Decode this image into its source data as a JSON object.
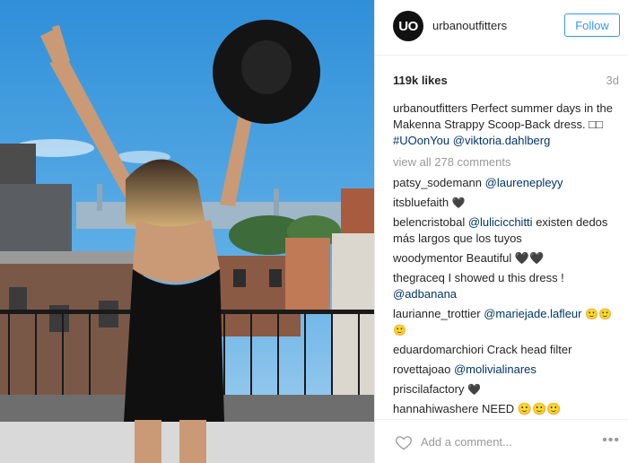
{
  "post": {
    "username": "urbanoutfitters",
    "avatar_text": "UO",
    "follow_label": "Follow",
    "likes": "119k likes",
    "age": "3d",
    "caption": {
      "user": "urbanoutfitters",
      "text": "Perfect summer days in the Makenna Strappy Scoop-Back dress.",
      "boxes": "□□",
      "hashtag": "#UOonYou",
      "mention": "@viktoria.dahlberg"
    },
    "view_all": "view all 278 comments",
    "comments": [
      {
        "user": "patsy_sodemann",
        "mention": "@laurenepleyy",
        "text": ""
      },
      {
        "user": "itsbluefaith",
        "text": "🖤"
      },
      {
        "user": "belencristobal",
        "mention": "@lulicicchitti",
        "text": "existen dedos más largos que los tuyos"
      },
      {
        "user": "woodymentor",
        "text": "Beautiful 🖤🖤"
      },
      {
        "user": "thegraceq",
        "text": "I showed u this dress !",
        "mention": "@adbanana"
      },
      {
        "user": "laurianne_trottier",
        "mention": "@mariejade.lafleur",
        "text": "🙂🙂🙂"
      },
      {
        "user": "eduardomarchiori",
        "text": "Crack head filter"
      },
      {
        "user": "rovettajoao",
        "mention": "@molivialinares",
        "text": ""
      },
      {
        "user": "priscilafactory",
        "text": "🖤"
      },
      {
        "user": "hannahiwashere",
        "text": "NEED 🙂🙂🙂"
      }
    ],
    "add_comment_placeholder": "Add a comment...",
    "more_label": "•••"
  },
  "icons": {
    "heart": "heart-icon",
    "more": "more-options-icon"
  },
  "colors": {
    "accent": "#3897f0",
    "link": "#003569",
    "muted": "#999999"
  }
}
